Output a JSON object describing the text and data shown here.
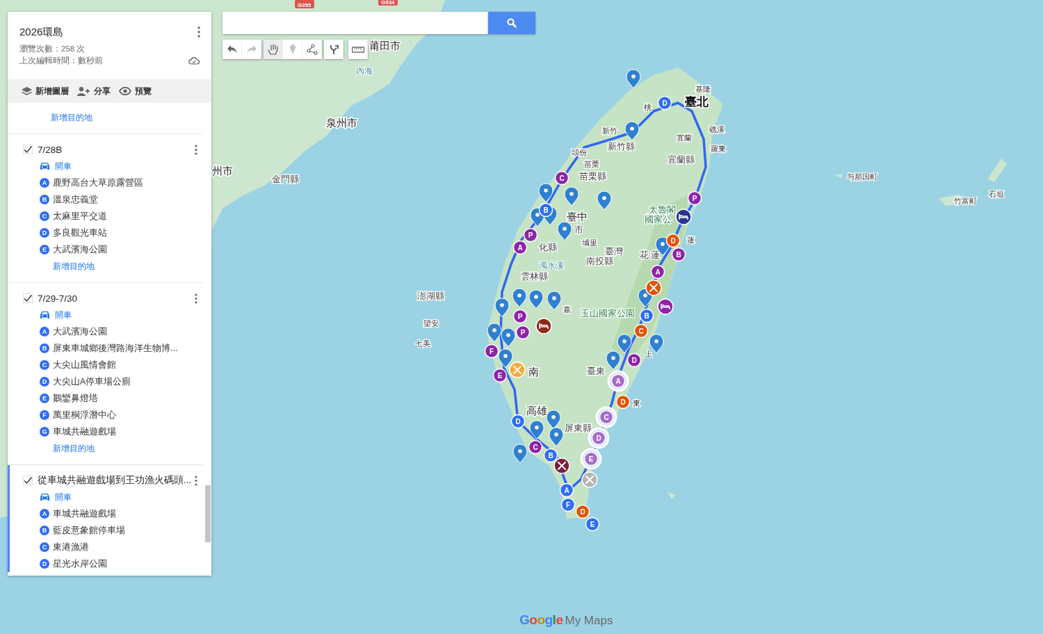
{
  "map": {
    "title": "2026環島",
    "view_count": "瀏覽次數：258 次",
    "last_edited": "上次編輯時間：數秒前"
  },
  "actions": [
    {
      "kind": "layers",
      "label": "新增圖層"
    },
    {
      "kind": "share",
      "label": "分享"
    },
    {
      "kind": "preview",
      "label": "預覽"
    }
  ],
  "top_link": "新增目的地",
  "layers": [
    {
      "title": "7/28B",
      "checked": true,
      "selected": false,
      "travel_mode": "開車",
      "stops": [
        {
          "letter": "A",
          "name": "鹿野高台大草原露營區"
        },
        {
          "letter": "B",
          "name": "溫泉忠義堂"
        },
        {
          "letter": "C",
          "name": "太麻里平交道"
        },
        {
          "letter": "D",
          "name": "多良觀光車站"
        },
        {
          "letter": "E",
          "name": "大武濱海公園"
        }
      ],
      "add_link": "新增目的地"
    },
    {
      "title": "7/29-7/30",
      "checked": true,
      "selected": false,
      "travel_mode": "開車",
      "stops": [
        {
          "letter": "A",
          "name": "大武濱海公園"
        },
        {
          "letter": "B",
          "name": "屏東車城鄉後灣路海洋生物博..."
        },
        {
          "letter": "C",
          "name": "大尖山風情會館"
        },
        {
          "letter": "D",
          "name": "大尖山A停車場公廁"
        },
        {
          "letter": "E",
          "name": "鵝鑾鼻燈塔"
        },
        {
          "letter": "F",
          "name": "萬里桐浮潛中心"
        },
        {
          "letter": "G",
          "name": "車城共融遊戲場"
        }
      ],
      "add_link": "新增目的地"
    },
    {
      "title": "從車城共融遊戲場到王功漁火碼頭...",
      "checked": true,
      "selected": true,
      "travel_mode": "開車",
      "stops": [
        {
          "letter": "A",
          "name": "車城共融遊戲場"
        },
        {
          "letter": "B",
          "name": "藍皮意象館停車場"
        },
        {
          "letter": "C",
          "name": "東港漁港"
        },
        {
          "letter": "D",
          "name": "星光水岸公園"
        }
      ]
    }
  ],
  "tools": [
    {
      "kind": "undo",
      "selected": false,
      "disabled": false
    },
    {
      "kind": "redo",
      "selected": false,
      "disabled": true
    },
    {
      "kind": "hand",
      "selected": true,
      "disabled": false
    },
    {
      "kind": "marker",
      "selected": false,
      "disabled": true
    },
    {
      "kind": "line",
      "selected": false,
      "disabled": false
    },
    {
      "kind": "directions",
      "selected": false,
      "disabled": false
    },
    {
      "kind": "ruler",
      "selected": false,
      "disabled": false
    }
  ],
  "map_labels": [
    {
      "text": "G355",
      "kind": "shield"
    },
    {
      "text": "G534",
      "kind": "shield"
    },
    {
      "text": "莆田市",
      "kind": "city"
    },
    {
      "text": "內海",
      "kind": "water"
    },
    {
      "text": "泉州市",
      "kind": "city"
    },
    {
      "text": "州市",
      "kind": "city"
    },
    {
      "text": "金門縣",
      "kind": "county"
    },
    {
      "text": "澎湖縣",
      "kind": "county"
    },
    {
      "text": "望安",
      "kind": "town"
    },
    {
      "text": "七美",
      "kind": "town"
    },
    {
      "text": "基隆",
      "kind": "town"
    },
    {
      "text": "臺北",
      "kind": "capital"
    },
    {
      "text": "桃",
      "kind": "town"
    },
    {
      "text": "新竹",
      "kind": "town"
    },
    {
      "text": "頭份",
      "kind": "town"
    },
    {
      "text": "新竹縣",
      "kind": "county"
    },
    {
      "text": "宜蘭",
      "kind": "town"
    },
    {
      "text": "礁溪",
      "kind": "town"
    },
    {
      "text": "羅東",
      "kind": "town"
    },
    {
      "text": "宜蘭縣",
      "kind": "county"
    },
    {
      "text": "苗栗",
      "kind": "town"
    },
    {
      "text": "苗栗縣",
      "kind": "county"
    },
    {
      "text": "臺中",
      "kind": "city"
    },
    {
      "text": "市",
      "kind": "county"
    },
    {
      "text": "化縣",
      "kind": "county"
    },
    {
      "text": "埔里",
      "kind": "town"
    },
    {
      "text": "臺灣",
      "kind": "county"
    },
    {
      "text": "南投縣",
      "kind": "county"
    },
    {
      "text": "濁水溪",
      "kind": "water"
    },
    {
      "text": "雲林縣",
      "kind": "county"
    },
    {
      "text": "花 蓮",
      "kind": "county"
    },
    {
      "text": "太魯閣",
      "kind": "park"
    },
    {
      "text": "國家公",
      "kind": "park"
    },
    {
      "text": "蓮",
      "kind": "town"
    },
    {
      "text": "嘉",
      "kind": "town"
    },
    {
      "text": "玉山國家公園",
      "kind": "park"
    },
    {
      "text": "南",
      "kind": "city"
    },
    {
      "text": "高雄",
      "kind": "city"
    },
    {
      "text": "屏東縣",
      "kind": "county"
    },
    {
      "text": "臺東",
      "kind": "county"
    },
    {
      "text": "東",
      "kind": "town"
    },
    {
      "text": "上",
      "kind": "town"
    },
    {
      "text": "与那国町",
      "kind": "town"
    },
    {
      "text": "竹富町",
      "kind": "town"
    },
    {
      "text": "石垣",
      "kind": "town"
    }
  ],
  "markers": [
    {
      "kind": "pin",
      "color": "#2f80d1"
    },
    {
      "kind": "pin",
      "color": "#2f80d1"
    },
    {
      "kind": "pin",
      "color": "#2f80d1"
    },
    {
      "kind": "pin",
      "color": "#2f80d1"
    },
    {
      "kind": "pin",
      "color": "#2f80d1"
    },
    {
      "kind": "pin",
      "color": "#2f80d1"
    },
    {
      "kind": "pin",
      "color": "#2f80d1"
    },
    {
      "kind": "pin",
      "color": "#2f80d1"
    },
    {
      "kind": "pin",
      "color": "#2f80d1"
    },
    {
      "kind": "pin",
      "color": "#2f80d1"
    },
    {
      "kind": "pin",
      "color": "#2f80d1"
    },
    {
      "kind": "pin",
      "color": "#2f80d1"
    },
    {
      "kind": "pin",
      "color": "#2f80d1"
    },
    {
      "kind": "pin",
      "color": "#2f80d1"
    },
    {
      "kind": "pin",
      "color": "#2f80d1"
    },
    {
      "kind": "pin",
      "color": "#2f80d1"
    },
    {
      "kind": "pin",
      "color": "#2f80d1"
    },
    {
      "kind": "pin",
      "color": "#2f80d1"
    },
    {
      "kind": "pin",
      "color": "#2f80d1"
    },
    {
      "kind": "pin",
      "color": "#2f80d1"
    },
    {
      "kind": "pin",
      "color": "#2f80d1"
    },
    {
      "kind": "pin",
      "color": "#2f80d1"
    },
    {
      "kind": "pin",
      "color": "#2f80d1"
    },
    {
      "kind": "pin",
      "color": "#2f80d1"
    },
    {
      "kind": "letter",
      "label": "D",
      "color": "#2f6ef3"
    },
    {
      "kind": "letter",
      "label": "C",
      "color": "#8e24aa"
    },
    {
      "kind": "letter",
      "label": "B",
      "color": "#2f6ef3"
    },
    {
      "kind": "letter",
      "label": "P",
      "color": "#8e24aa"
    },
    {
      "kind": "letter",
      "label": "A",
      "color": "#8e24aa"
    },
    {
      "kind": "letter",
      "label": "P",
      "color": "#8e24aa"
    },
    {
      "kind": "bed",
      "color": "#283593"
    },
    {
      "kind": "letter",
      "label": "D",
      "color": "#e65100"
    },
    {
      "kind": "letter",
      "label": "B",
      "color": "#8e24aa"
    },
    {
      "kind": "letter",
      "label": "A",
      "color": "#8e24aa"
    },
    {
      "kind": "food",
      "color": "#e65100"
    },
    {
      "kind": "letter",
      "label": "B",
      "color": "#2f6ef3"
    },
    {
      "kind": "bed",
      "color": "#8e24aa"
    },
    {
      "kind": "letter",
      "label": "C",
      "color": "#e65100"
    },
    {
      "kind": "letter",
      "label": "D",
      "color": "#8e24aa"
    },
    {
      "kind": "letter",
      "label": "P",
      "color": "#8e24aa"
    },
    {
      "kind": "letter",
      "label": "P",
      "color": "#8e24aa"
    },
    {
      "kind": "bed",
      "color": "#8d2a1a"
    },
    {
      "kind": "letter",
      "label": "F",
      "color": "#8e24aa"
    },
    {
      "kind": "letter",
      "label": "E",
      "color": "#8e24aa"
    },
    {
      "kind": "food",
      "color": "#f4a93a"
    },
    {
      "kind": "letter",
      "label": "A",
      "color": "#a56cc9"
    },
    {
      "kind": "letter",
      "label": "D",
      "color": "#e65100"
    },
    {
      "kind": "letter",
      "label": "C",
      "color": "#a56cc9"
    },
    {
      "kind": "letter",
      "label": "D",
      "color": "#a56cc9"
    },
    {
      "kind": "letter",
      "label": "E",
      "color": "#a56cc9"
    },
    {
      "kind": "letter",
      "label": "D",
      "color": "#2f6ef3"
    },
    {
      "kind": "letter",
      "label": "C",
      "color": "#8e24aa"
    },
    {
      "kind": "letter",
      "label": "B",
      "color": "#2f6ef3"
    },
    {
      "kind": "food",
      "color": "#7b1e3a"
    },
    {
      "kind": "food",
      "color": "#b5b5b5"
    },
    {
      "kind": "letter",
      "label": "A",
      "color": "#2f6ef3"
    },
    {
      "kind": "letter",
      "label": "F",
      "color": "#2f6ef3"
    },
    {
      "kind": "letter",
      "label": "D",
      "color": "#e65100"
    },
    {
      "kind": "letter",
      "label": "E",
      "color": "#2f6ef3"
    }
  ],
  "logo": {
    "brand": "Google",
    "product": "My Maps"
  }
}
